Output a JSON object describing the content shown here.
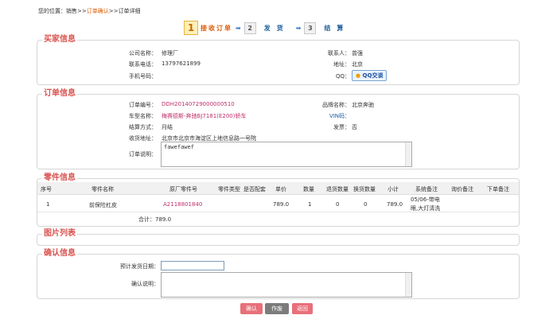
{
  "breadcrumb": {
    "prefix": "您的位置：销售>>",
    "current": "订单确认",
    "suffix": ">>订单详细"
  },
  "steps": [
    {
      "num": "1",
      "label": "接收订单"
    },
    {
      "num": "2",
      "label": "发货"
    },
    {
      "num": "3",
      "label": "结算"
    }
  ],
  "arrow": "➡",
  "buyer": {
    "legend": "买家信息",
    "company_label": "公司名称：",
    "company": "修理厂",
    "contact_label": "联系人：",
    "contact": "曾强",
    "phone_label": "联系电话：",
    "phone": "13797621899",
    "address_label": "地址：",
    "address": "北京",
    "mobile_label": "手机号码：",
    "mobile": "",
    "qq_label": "QQ：",
    "qq_button": "QQ交谈"
  },
  "order": {
    "legend": "订单信息",
    "order_no_label": "订单编号：",
    "order_no": "DDH20140729000000510",
    "brand_label": "品牌名称：",
    "brand": "北京奔驰",
    "model_label": "车型名称：",
    "model": "梅赛德斯-奔驰BJ7181(E200)轿车",
    "vin_label": "VIN码：",
    "vin": "",
    "settle_label": "结算方式：",
    "settle": "月结",
    "invoice_label": "发票：",
    "invoice": "否",
    "ship_addr_label": "收货地址：",
    "ship_addr": "北京市北京市海淀区上地信息路一号院",
    "memo_label": "订单说明：",
    "memo": "fawefawef"
  },
  "parts": {
    "legend": "零件信息",
    "headers": [
      "序号",
      "零件名称",
      "原厂零件号",
      "零件类型",
      "是否配套",
      "单价",
      "数量",
      "退货数量",
      "换货数量",
      "小计",
      "系统备注",
      "询价备注",
      "下单备注"
    ],
    "row": {
      "seq": "1",
      "name": "前保险杠皮",
      "oem": "A2118801840",
      "type": "",
      "matched": "",
      "price": "789.0",
      "qty": "1",
      "returned": "0",
      "exchanged": "0",
      "subtotal": "789.0",
      "sys_note_1": "05/06-带电",
      "sys_note_2": "眼,大灯清洗",
      "inquiry_note": "",
      "order_note": ""
    },
    "total_label": "合计：",
    "total": "789.0"
  },
  "images": {
    "legend": "图片列表"
  },
  "confirm": {
    "legend": "确认信息",
    "ship_date_label": "预计发货日期：",
    "ship_date": "",
    "note_label": "确认说明：",
    "note": ""
  },
  "buttons": {
    "confirm": "确认",
    "void": "作废",
    "back": "返回"
  },
  "colors": {
    "accent_red": "#d9534f",
    "button_pink": "#e8707a",
    "button_gray": "#7c7c7c",
    "link_blue": "#1d5d9b"
  }
}
